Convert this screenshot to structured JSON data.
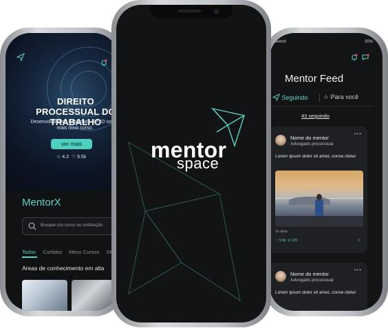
{
  "left_phone": {
    "hero": {
      "title": "DIREITO PROCESSUAL DO TRABALHO",
      "subtitle": "Desenvolva suas habilidade XPTO com o mais novo curso.",
      "button": "ver mais",
      "rating": "4.2",
      "likes": "5.5k"
    },
    "brand": "MentorX",
    "search": {
      "placeholder": "Busque um curso ou instituição"
    },
    "tabs": [
      "Todos",
      "Curtidos",
      "Meus Cursos",
      "Skil"
    ],
    "active_tab": "Todos",
    "section_title": "Areas de conhecimento em alta"
  },
  "center_phone": {
    "logo_top": "mentor",
    "logo_bottom": "space"
  },
  "right_phone": {
    "status": {
      "carrier": "Sketch",
      "battery": "30%"
    },
    "title": "Mentor Feed",
    "segments": {
      "following": "Seguindo",
      "for_you": "Para você"
    },
    "following_count": "43 seguindo",
    "posts": [
      {
        "mentor_name": "Nome do mentor",
        "mentor_role": "Advogado processual",
        "body": "Lorem ipsum dolor sit amet, conse ctetur",
        "time": "1h atrás",
        "likes": "5.5k",
        "shares": "120"
      },
      {
        "mentor_name": "Nome do mentor",
        "mentor_role": "Advogado processual",
        "body": "Lorem ipsum dolor sit amet, conse ctetur"
      }
    ]
  },
  "colors": {
    "accent": "#5fd3c4",
    "screen_bg": "#121314",
    "card_bg": "#1f2023"
  }
}
